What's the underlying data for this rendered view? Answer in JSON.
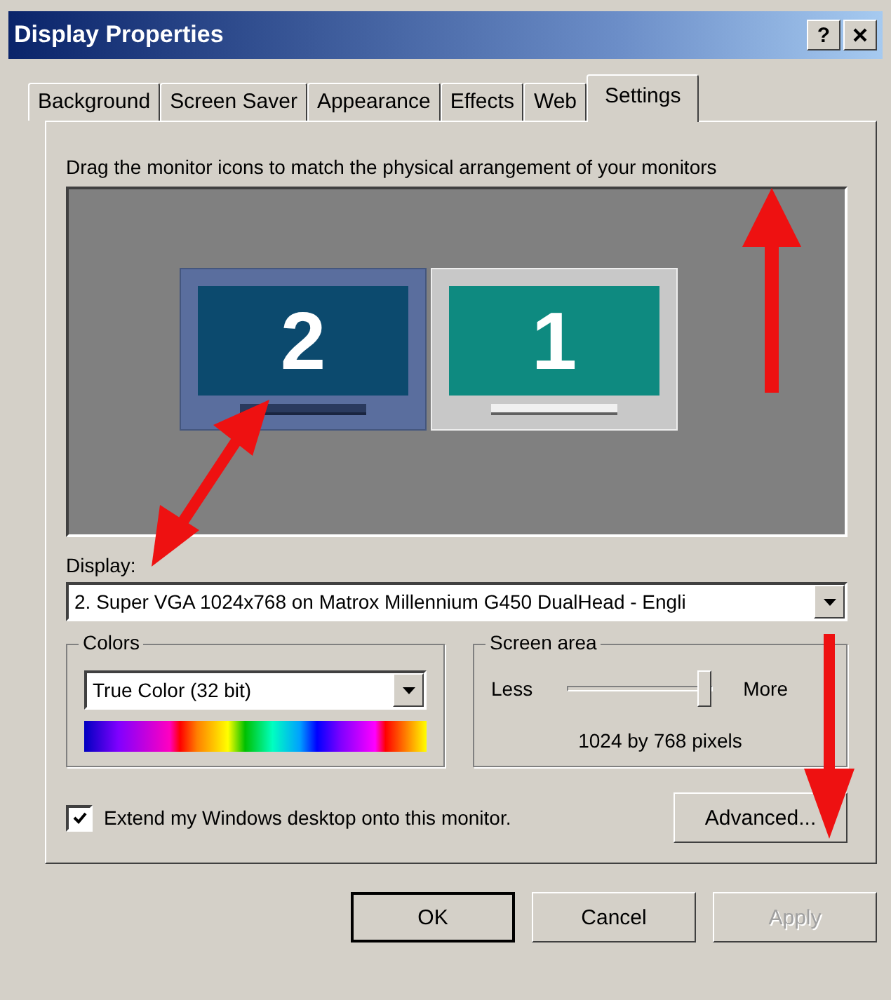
{
  "window": {
    "title": "Display Properties",
    "help_button": "?"
  },
  "tabs": [
    {
      "label": "Background",
      "selected": false
    },
    {
      "label": "Screen Saver",
      "selected": false
    },
    {
      "label": "Appearance",
      "selected": false
    },
    {
      "label": "Effects",
      "selected": false
    },
    {
      "label": "Web",
      "selected": false
    },
    {
      "label": "Settings",
      "selected": true
    }
  ],
  "instruction": "Drag the monitor icons to match the physical arrangement of your monitors",
  "monitors": [
    {
      "label": "2",
      "selected": true
    },
    {
      "label": "1",
      "selected": false
    }
  ],
  "display": {
    "label": "Display:",
    "value": "2. Super VGA 1024x768 on Matrox Millennium G450 DualHead  - Engli"
  },
  "colors": {
    "label": "Colors",
    "value": "True Color (32 bit)"
  },
  "screen_area": {
    "label": "Screen area",
    "min_label": "Less",
    "max_label": "More",
    "level": 0.95,
    "reading": "1024 by 768 pixels"
  },
  "extend": {
    "label": "Extend my Windows desktop onto this monitor.",
    "checked": true
  },
  "advanced_button": {
    "label": "Advanced...",
    "disabled": false
  },
  "buttons": [
    {
      "label": "OK",
      "disabled": false,
      "default": true
    },
    {
      "label": "Cancel",
      "disabled": false,
      "default": false
    },
    {
      "label": "Apply",
      "disabled": true,
      "default": false
    }
  ]
}
